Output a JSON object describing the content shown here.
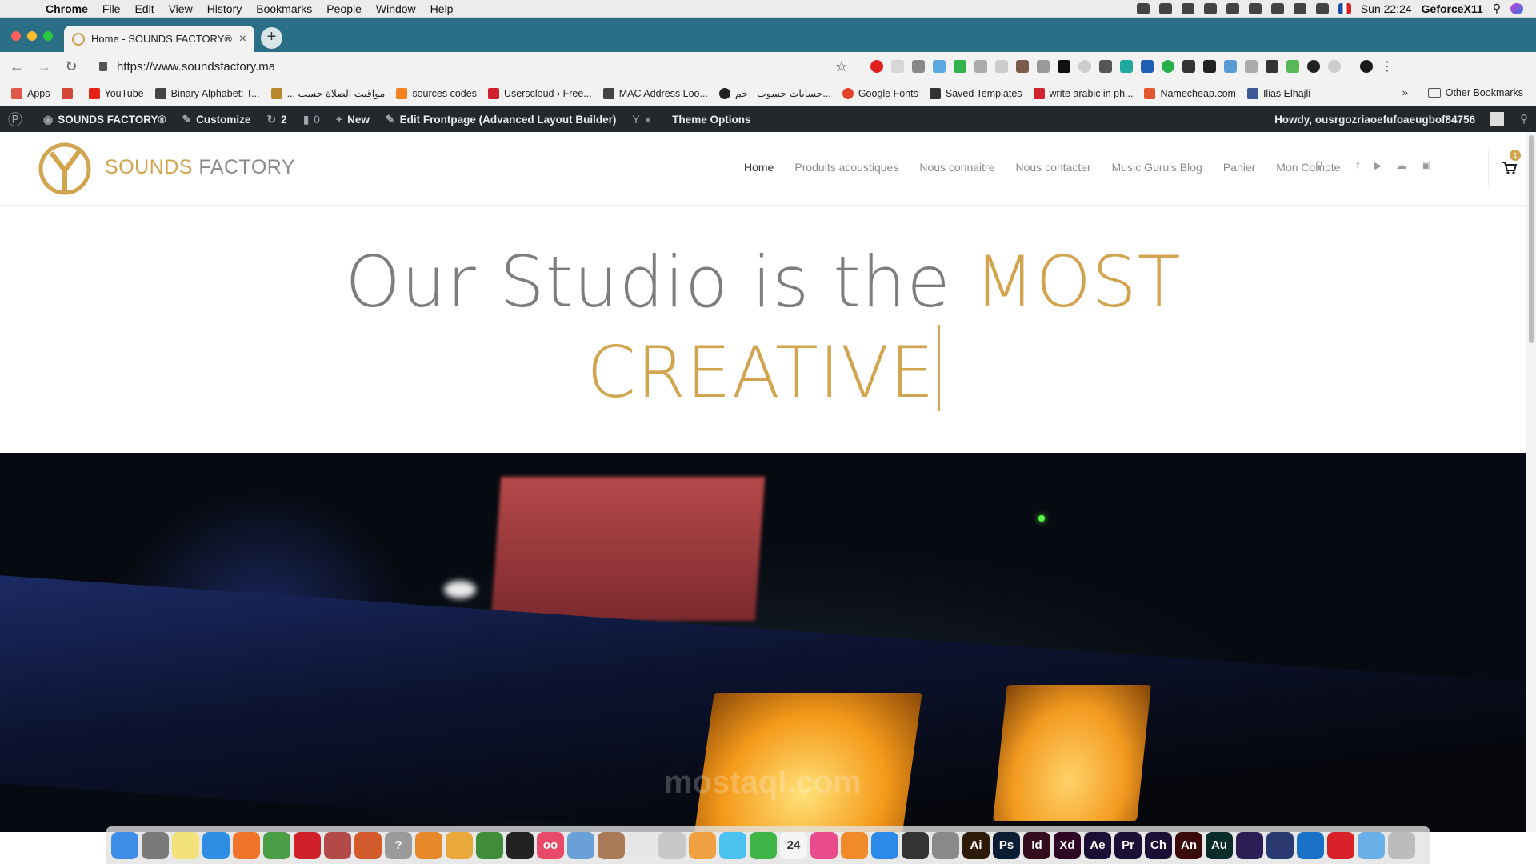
{
  "menubar": {
    "app": "Chrome",
    "items": [
      "File",
      "Edit",
      "View",
      "History",
      "Bookmarks",
      "People",
      "Window",
      "Help"
    ],
    "clock": "Sun 22:24",
    "user": "GeforceX11"
  },
  "tab": {
    "title": "Home - SOUNDS FACTORY®"
  },
  "toolbar": {
    "url": "https://www.soundsfactory.ma"
  },
  "bookmarks": {
    "items": [
      {
        "label": "Apps",
        "color": "#e0574b"
      },
      {
        "label": "",
        "color": "#d44638"
      },
      {
        "label": "YouTube",
        "color": "#e62117"
      },
      {
        "label": "Binary Alphabet: T...",
        "color": "#444444"
      },
      {
        "label": "... مواقيت الصلاة حسب",
        "color": "#b88a2c"
      },
      {
        "label": "sources codes",
        "color": "#f58220"
      },
      {
        "label": "Userscloud › Free...",
        "color": "#d0212f"
      },
      {
        "label": "MAC Address Loo...",
        "color": "#444444"
      },
      {
        "label": "حسابات حسوب - جم...",
        "color": "#222222"
      },
      {
        "label": "Google Fonts",
        "color": "#e2452c"
      },
      {
        "label": "Saved Templates",
        "color": "#333333"
      },
      {
        "label": "write arabic in ph...",
        "color": "#d0212f"
      },
      {
        "label": "Namecheap.com",
        "color": "#e4572e"
      },
      {
        "label": "Ilias Elhajli",
        "color": "#3b5998"
      }
    ],
    "more": "»",
    "other": "Other Bookmarks"
  },
  "wpbar": {
    "site": "SOUNDS FACTORY®",
    "customize": "Customize",
    "updates": "2",
    "comments": "0",
    "new": "New",
    "edit": "Edit Frontpage (Advanced Layout Builder)",
    "theme": "Theme Options",
    "howdy": "Howdy, ousrgozriaoefufoaeugbof84756"
  },
  "site": {
    "logo_a": "SOUNDS",
    "logo_b": "FACTORY",
    "nav": [
      "Home",
      "Produits acoustiques",
      "Nous connaitre",
      "Nous contacter",
      "Music Guru's Blog",
      "Panier",
      "Mon Compte"
    ],
    "cart_count": "1",
    "brand_color": "#d1a54f"
  },
  "hero": {
    "line1_a": "Our Studio is the ",
    "line1_b": "MOST",
    "line2": "CREATIVE",
    "watermark": "mostaql.com"
  },
  "dock": {
    "icons": [
      {
        "name": "finder-icon",
        "color": "#3e8ee8",
        "glyph": ""
      },
      {
        "name": "launchpad-icon",
        "color": "#7a7a7a",
        "glyph": ""
      },
      {
        "name": "notes-icon",
        "color": "#f3e27a",
        "glyph": ""
      },
      {
        "name": "safari-icon",
        "color": "#2f8de4",
        "glyph": ""
      },
      {
        "name": "firefox-icon",
        "color": "#f0742a",
        "glyph": ""
      },
      {
        "name": "chrome-icon",
        "color": "#4a9e45",
        "glyph": ""
      },
      {
        "name": "opera-icon",
        "color": "#d0202c",
        "glyph": ""
      },
      {
        "name": "app-icon",
        "color": "#b34a4a",
        "glyph": ""
      },
      {
        "name": "app-icon",
        "color": "#d35a2c",
        "glyph": ""
      },
      {
        "name": "help-icon",
        "color": "#9a9a9a",
        "glyph": "?"
      },
      {
        "name": "blender-icon",
        "color": "#e8882a",
        "glyph": ""
      },
      {
        "name": "package-icon",
        "color": "#e8a93a",
        "glyph": ""
      },
      {
        "name": "android-studio-icon",
        "color": "#3f8c3b",
        "glyph": ""
      },
      {
        "name": "unity-icon",
        "color": "#222222",
        "glyph": ""
      },
      {
        "name": "app-icon",
        "color": "#e94a6a",
        "glyph": "oo"
      },
      {
        "name": "preview-icon",
        "color": "#6aa0d8",
        "glyph": ""
      },
      {
        "name": "app-icon",
        "color": "#a97a55",
        "glyph": ""
      },
      {
        "name": "app-icon",
        "color": "#e6e6e6",
        "glyph": ""
      },
      {
        "name": "app-icon",
        "color": "#c8c8c8",
        "glyph": ""
      },
      {
        "name": "photos-icon",
        "color": "#f0a040",
        "glyph": ""
      },
      {
        "name": "messages-icon",
        "color": "#4cc2f1",
        "glyph": ""
      },
      {
        "name": "facetime-icon",
        "color": "#3fb548",
        "glyph": ""
      },
      {
        "name": "calendar-icon",
        "color": "#f5f5f5",
        "glyph": "24"
      },
      {
        "name": "itunes-icon",
        "color": "#ea4b8a",
        "glyph": ""
      },
      {
        "name": "books-icon",
        "color": "#f08a2a",
        "glyph": ""
      },
      {
        "name": "app-store-icon",
        "color": "#2b8ae8",
        "glyph": ""
      },
      {
        "name": "obs-icon",
        "color": "#333333",
        "glyph": ""
      },
      {
        "name": "system-preferences-icon",
        "color": "#8a8a8a",
        "glyph": ""
      },
      {
        "name": "illustrator-icon",
        "color": "#2d1a08",
        "glyph": "Ai"
      },
      {
        "name": "photoshop-icon",
        "color": "#0b1d33",
        "glyph": "Ps"
      },
      {
        "name": "indesign-icon",
        "color": "#330d1e",
        "glyph": "Id"
      },
      {
        "name": "xd-icon",
        "color": "#2e0524",
        "glyph": "Xd"
      },
      {
        "name": "after-effects-icon",
        "color": "#1c0f36",
        "glyph": "Ae"
      },
      {
        "name": "premiere-icon",
        "color": "#1c0f36",
        "glyph": "Pr"
      },
      {
        "name": "character-animator-icon",
        "color": "#1c0f36",
        "glyph": "Ch"
      },
      {
        "name": "animate-icon",
        "color": "#3a0a0a",
        "glyph": "An"
      },
      {
        "name": "audition-icon",
        "color": "#0b2d2a",
        "glyph": "Au"
      },
      {
        "name": "app-icon",
        "color": "#2c1e55",
        "glyph": ""
      },
      {
        "name": "app-icon",
        "color": "#2a3a70",
        "glyph": ""
      },
      {
        "name": "teamviewer-icon",
        "color": "#1a72c8",
        "glyph": ""
      },
      {
        "name": "creative-cloud-icon",
        "color": "#d82028",
        "glyph": ""
      },
      {
        "name": "folder-icon",
        "color": "#6ab0e8",
        "glyph": ""
      },
      {
        "name": "trash-icon",
        "color": "#bcbcbc",
        "glyph": ""
      }
    ]
  }
}
